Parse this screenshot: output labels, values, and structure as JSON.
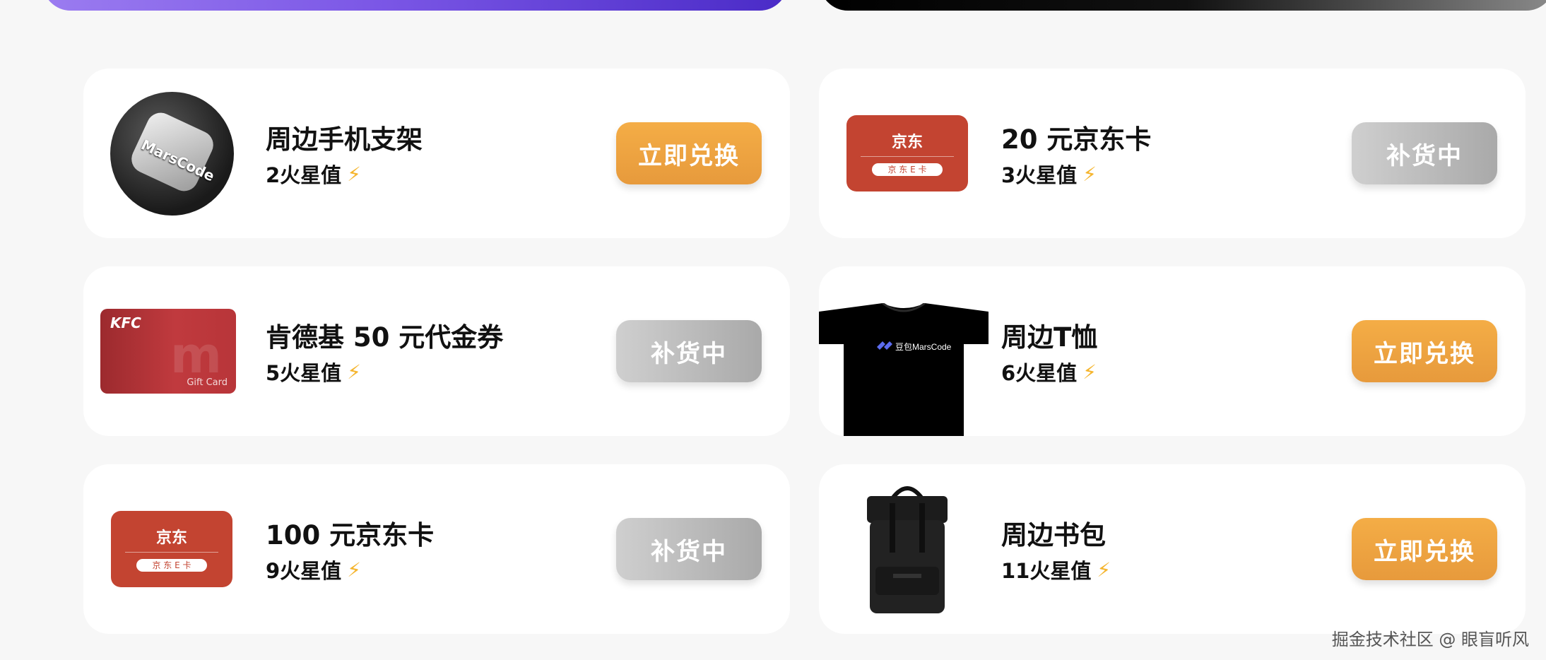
{
  "items": [
    {
      "title": "周边手机支架",
      "cost": "2火星值",
      "button": "立即兑换",
      "status": "active",
      "thumb": "marscode-badge",
      "thumb_text": "MarsCode"
    },
    {
      "title": "20 元京东卡",
      "cost": "3火星值",
      "button": "补货中",
      "status": "disabled",
      "thumb": "jd-card",
      "thumb_logo": "京东",
      "thumb_pill": "京 东 E 卡"
    },
    {
      "title": "肯德基 50 元代金券",
      "cost": "5火星值",
      "button": "补货中",
      "status": "disabled",
      "thumb": "kfc-card",
      "thumb_logo": "KFC",
      "thumb_caption": "Gift Card"
    },
    {
      "title": "周边T恤",
      "cost": "6火星值",
      "button": "立即兑换",
      "status": "active",
      "thumb": "tshirt",
      "thumb_text": "豆包MarsCode"
    },
    {
      "title": "100 元京东卡",
      "cost": "9火星值",
      "button": "补货中",
      "status": "disabled",
      "thumb": "jd-card",
      "thumb_logo": "京东",
      "thumb_pill": "京 东 E 卡"
    },
    {
      "title": "周边书包",
      "cost": "11火星值",
      "button": "立即兑换",
      "status": "active",
      "thumb": "backpack"
    }
  ],
  "watermark": "掘金技术社区 @ 眼盲听风",
  "colors": {
    "active_button": "#eaa040",
    "disabled_button": "#bdbdbd",
    "jd_red": "#c34431",
    "kfc_red": "#a82f33"
  },
  "icons": {
    "cost_icon": "lightning-bolt-icon"
  }
}
